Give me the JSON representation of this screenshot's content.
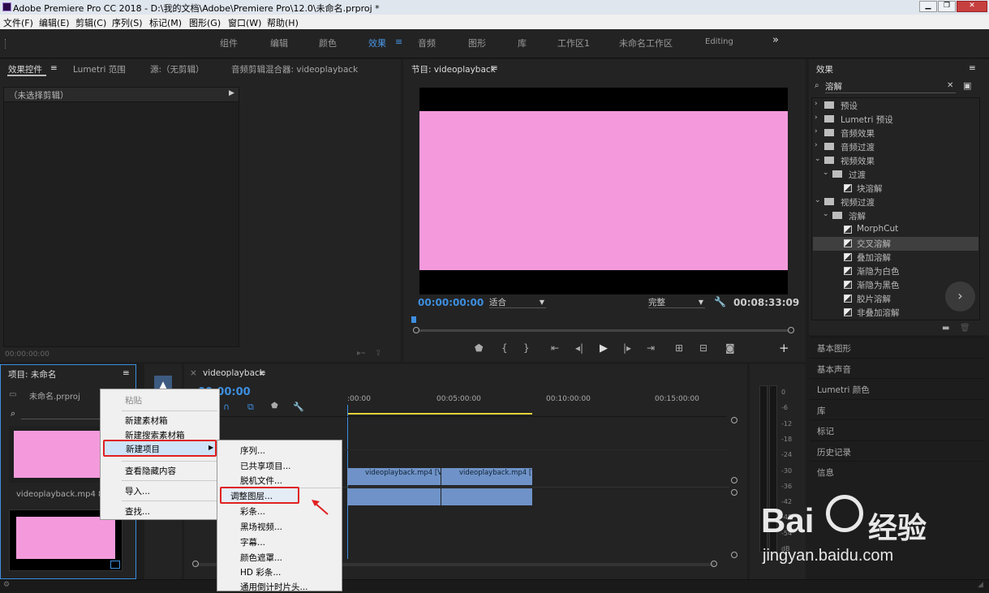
{
  "window": {
    "title": "Adobe Premiere Pro CC 2018 - D:\\我的文档\\Adobe\\Premiere Pro\\12.0\\未命名.prproj *"
  },
  "menubar": [
    "文件(F)",
    "编辑(E)",
    "剪辑(C)",
    "序列(S)",
    "标记(M)",
    "图形(G)",
    "窗口(W)",
    "帮助(H)"
  ],
  "workspaces": [
    "组件",
    "编辑",
    "颜色",
    "效果",
    "音频",
    "图形",
    "库",
    "工作区1",
    "未命名工作区",
    "Editing"
  ],
  "active_workspace": "效果",
  "more": "»",
  "source_panel": {
    "tabs": [
      "效果控件",
      "Lumetri 范围",
      "源:（无剪辑）",
      "音频剪辑混合器: videoplayback"
    ],
    "no_clip": "（未选择剪辑）",
    "timecode": "00:00:00:00"
  },
  "program_monitor": {
    "title": "节目: videoplayback",
    "timecode": "00:00:00:00",
    "fit": "适合",
    "quality": "完整",
    "duration": "00:08:33:09",
    "frame_color": "#f49adc"
  },
  "effects_panel": {
    "title": "效果",
    "search": "溶解",
    "tree": [
      {
        "label": "预设",
        "level": 0,
        "kind": "folder-star"
      },
      {
        "label": "Lumetri 预设",
        "level": 0,
        "kind": "folder-star"
      },
      {
        "label": "音频效果",
        "level": 0,
        "kind": "folder"
      },
      {
        "label": "音频过渡",
        "level": 0,
        "kind": "folder"
      },
      {
        "label": "视频效果",
        "level": 0,
        "kind": "folder"
      },
      {
        "label": "过渡",
        "level": 1,
        "kind": "folder"
      },
      {
        "label": "块溶解",
        "level": 2,
        "kind": "effect"
      },
      {
        "label": "视频过渡",
        "level": 0,
        "kind": "folder"
      },
      {
        "label": "溶解",
        "level": 1,
        "kind": "folder"
      },
      {
        "label": "MorphCut",
        "level": 2,
        "kind": "transition"
      },
      {
        "label": "交叉溶解",
        "level": 2,
        "kind": "transition",
        "selected": true
      },
      {
        "label": "叠加溶解",
        "level": 2,
        "kind": "transition"
      },
      {
        "label": "渐隐为白色",
        "level": 2,
        "kind": "transition"
      },
      {
        "label": "渐隐为黑色",
        "level": 2,
        "kind": "transition"
      },
      {
        "label": "胶片溶解",
        "level": 2,
        "kind": "transition"
      },
      {
        "label": "非叠加溶解",
        "level": 2,
        "kind": "transition"
      }
    ]
  },
  "side_panels": [
    "基本图形",
    "基本声音",
    "Lumetri 颜色",
    "库",
    "标记",
    "历史记录",
    "信息"
  ],
  "project_panel": {
    "title": "项目: 未命名",
    "file": "未命名.prproj",
    "clip": "videoplayback.mp4",
    "clip_duration": "8"
  },
  "timeline": {
    "title": "videoplayback",
    "timecode": "00:00:00",
    "ruler": [
      ":00:00",
      "00:05:00:00",
      "00:10:00:00",
      "00:15:00:00"
    ],
    "clips": [
      "videoplayback.mp4 [V]",
      "videoplayback.mp4 [V]"
    ]
  },
  "meter": [
    "0",
    "-6",
    "-12",
    "-18",
    "-24",
    "-30",
    "-36",
    "-42",
    "-48",
    "-54",
    "dB"
  ],
  "context_menu": [
    "粘贴",
    "新建素材箱",
    "新建搜索素材箱",
    "新建项目",
    "查看隐藏内容",
    "导入...",
    "查找..."
  ],
  "submenu": [
    "序列...",
    "已共享项目...",
    "脱机文件...",
    "调整图层...",
    "彩条...",
    "黑场视频...",
    "字幕...",
    "颜色遮罩...",
    "HD 彩条...",
    "通用倒计时片头..."
  ],
  "watermark": {
    "brand": "Bai",
    "brand2": "经验",
    "url": "jingyan.baidu.com"
  }
}
